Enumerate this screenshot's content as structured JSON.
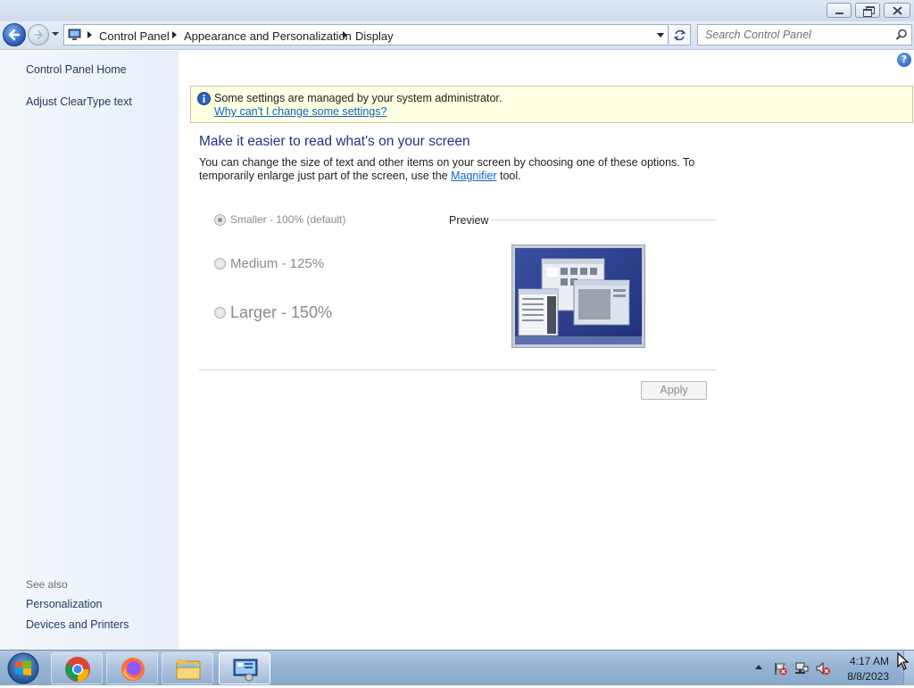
{
  "window": {
    "minimize_icon": "minimize-icon",
    "maximize_icon": "restore-icon",
    "close_icon": "close-icon"
  },
  "navbar": {
    "breadcrumbs": [
      "Control Panel",
      "Appearance and Personalization",
      "Display"
    ],
    "search_placeholder": "Search Control Panel"
  },
  "sidebar": {
    "tasks": [
      "Control Panel Home",
      "Adjust ClearType text"
    ],
    "see_also_title": "See also",
    "see_also": [
      "Personalization",
      "Devices and Printers"
    ]
  },
  "infobar": {
    "message": "Some settings are managed by your system administrator.",
    "link": "Why can't I change some settings?"
  },
  "main": {
    "title": "Make it easier to read what's on your screen",
    "desc_before": "You can change the size of text and other items on your screen by choosing one of these options. To temporarily enlarge just part of the screen, use the ",
    "desc_link": "Magnifier",
    "desc_after": " tool.",
    "options": [
      {
        "label": "Smaller - 100% (default)",
        "checked": true
      },
      {
        "label": "Medium - 125%",
        "checked": false
      },
      {
        "label": "Larger - 150%",
        "checked": false
      }
    ],
    "preview_label": "Preview",
    "apply_label": "Apply"
  },
  "taskbar": {
    "apps": [
      "Google Chrome",
      "Firefox",
      "Windows Explorer",
      "Control Panel"
    ],
    "time": "4:17 AM",
    "date": "8/8/2023"
  },
  "colors": {
    "link": "#0b65c2",
    "heading": "#1e3287",
    "infobar_bg": "#ffffe1"
  }
}
